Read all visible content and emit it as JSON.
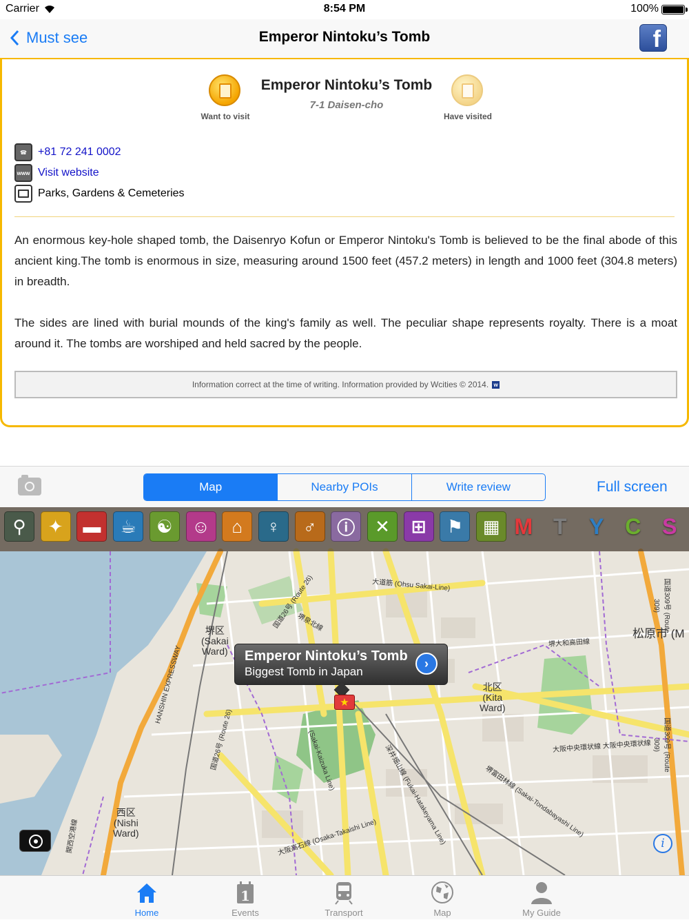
{
  "status_bar": {
    "carrier": "Carrier",
    "time": "8:54 PM",
    "battery": "100%"
  },
  "nav": {
    "back_label": "Must see",
    "title": "Emperor Nintoku’s Tomb"
  },
  "poi": {
    "name": "Emperor Nintoku’s Tomb",
    "address": "7-1 Daisen-cho",
    "want_to_visit": "Want to visit",
    "have_visited": "Have visited",
    "phone": "+81 72 241 0002",
    "website": "Visit website",
    "category": "Parks, Gardens & Cemeteries",
    "description": [
      "An enormous key-hole shaped tomb, the Daisenryo Kofun or Emperor Nintoku's Tomb is believed to be the final abode of this ancient king.The tomb is enormous in size, measuring around 1500 feet (457.2 meters) in length and 1000 feet (304.8 meters) in breadth.",
      "The sides are lined with burial mounds of the king's family as well. The peculiar shape represents royalty. There is a moat around it. The tombs are worshiped and held sacred by the people."
    ],
    "credit": "Information correct at the time of writing. Information provided by Wcities © 2014.",
    "credit_logo": "w"
  },
  "segments": {
    "items": [
      "Map",
      "Nearby POIs",
      "Write review"
    ],
    "selected": "Map",
    "full_screen": "Full screen"
  },
  "categories": [
    {
      "icon": "search-icon",
      "color": "#4a5a4a",
      "glyph": "⚲"
    },
    {
      "icon": "ticket-icon",
      "color": "#d8a31c",
      "glyph": "✦"
    },
    {
      "icon": "bed-icon",
      "color": "#c2312f",
      "glyph": "▬"
    },
    {
      "icon": "cafe-icon",
      "color": "#2a7bb8",
      "glyph": "☕"
    },
    {
      "icon": "spa-icon",
      "color": "#6a9a30",
      "glyph": "☯"
    },
    {
      "icon": "theater-icon",
      "color": "#b33a8a",
      "glyph": "☺"
    },
    {
      "icon": "museum-icon",
      "color": "#d37a1e",
      "glyph": "⌂"
    },
    {
      "icon": "nightlife-icon",
      "color": "#2a6a8a",
      "glyph": "♀"
    },
    {
      "icon": "walking-icon",
      "color": "#b86a1a",
      "glyph": "♂"
    },
    {
      "icon": "info-icon",
      "color": "#8a6aa0",
      "glyph": "ⓘ"
    },
    {
      "icon": "restaurant-icon",
      "color": "#5a9a2a",
      "glyph": "✕"
    },
    {
      "icon": "shopping-icon",
      "color": "#8a3aa8",
      "glyph": "⊞"
    },
    {
      "icon": "pin-icon",
      "color": "#3a7aa8",
      "glyph": "⚑"
    },
    {
      "icon": "train-icon",
      "color": "#6a8a2a",
      "glyph": "▦"
    }
  ],
  "category_letters": [
    {
      "letter": "M",
      "color": "#e5383b"
    },
    {
      "letter": "T",
      "color": "#7d7d7d"
    },
    {
      "letter": "Y",
      "color": "#2e7ec4"
    },
    {
      "letter": "C",
      "color": "#6bae2e"
    },
    {
      "letter": "S",
      "color": "#c93aa3"
    }
  ],
  "map": {
    "callout_title": "Emperor Nintoku’s Tomb",
    "callout_subtitle": "Biggest Tomb in Japan",
    "labels": {
      "sakai": "堺区\n(Sakai\nWard)",
      "kita": "北区\n(Kita\nWard)",
      "nishi": "西区\n(Nishi\nWard)",
      "matsubara": "松原市 (M",
      "ohsu_sakai": "大道筋 (Ohsu Sakai-Line)",
      "route309a": "国道309号 (Route 309)",
      "route309b": "国道309号 (Route 309)",
      "osaka_takaishi": "大阪高石線 (Osaka-Takaishi Line)",
      "sakai_tondabayashi": "堺富田林線 (Sakai-Tondabayashi Line)",
      "fukai_hatakeyama": "深井畑山線 (Fukai-Hatakeyama Line)",
      "hanshin": "HANSHIN EXPRESSWAY",
      "route26": "国道26号 (Route 26)",
      "osaka_chuo": "大阪中央環状線 大阪中央環状線",
      "sakai_daiwa": "堺大和高田線",
      "route26b": "国道26号 (Route 26)",
      "shimizu_line": "堺泉北線",
      "sakai_kaizuka": "(Sakai-Kaizuka Line)",
      "matsubara_line": "関西空港線"
    }
  },
  "tabs": [
    {
      "label": "Home",
      "icon": "home-icon",
      "active": true
    },
    {
      "label": "Events",
      "icon": "calendar-icon",
      "active": false
    },
    {
      "label": "Transport",
      "icon": "train-icon",
      "active": false
    },
    {
      "label": "Map",
      "icon": "globe-icon",
      "active": false
    },
    {
      "label": "My Guide",
      "icon": "person-icon",
      "active": false
    }
  ]
}
